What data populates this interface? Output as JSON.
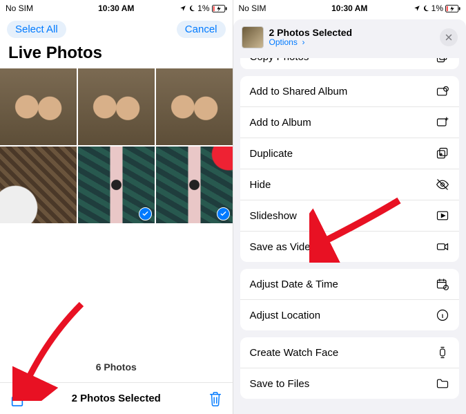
{
  "status": {
    "carrier": "No SIM",
    "time": "10:30 AM",
    "battery": "1%"
  },
  "left": {
    "select_all": "Select All",
    "cancel": "Cancel",
    "title": "Live Photos",
    "count_label": "6 Photos",
    "selected_label": "2 Photos Selected"
  },
  "right": {
    "header_title": "2 Photos Selected",
    "options_label": "Options",
    "actions": {
      "copy_photos": "Copy Photos",
      "shared_album": "Add to Shared Album",
      "add_album": "Add to Album",
      "duplicate": "Duplicate",
      "hide": "Hide",
      "slideshow": "Slideshow",
      "save_video": "Save as Video",
      "adjust_date": "Adjust Date & Time",
      "adjust_loc": "Adjust Location",
      "watch_face": "Create Watch Face",
      "save_files": "Save to Files"
    }
  }
}
